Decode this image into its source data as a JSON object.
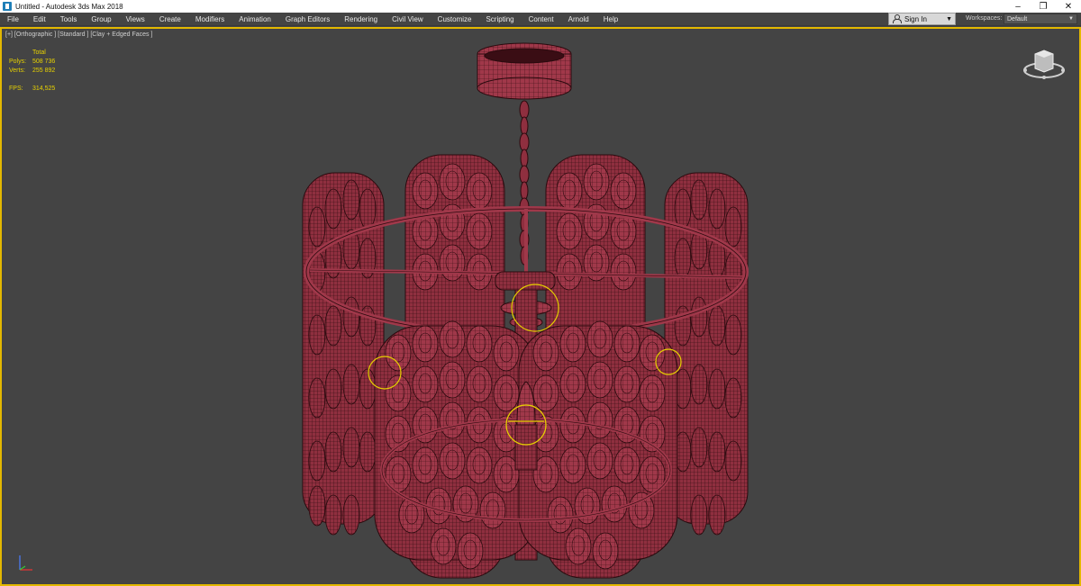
{
  "window": {
    "title": "Untitled - Autodesk 3ds Max 2018",
    "controls": {
      "minimize": "–",
      "restore": "❐",
      "close": "✕"
    }
  },
  "menu": [
    "File",
    "Edit",
    "Tools",
    "Group",
    "Views",
    "Create",
    "Modifiers",
    "Animation",
    "Graph Editors",
    "Rendering",
    "Civil View",
    "Customize",
    "Scripting",
    "Content",
    "Arnold",
    "Help"
  ],
  "account": {
    "sign_in_label": "Sign In",
    "caret": "▼"
  },
  "workspaces": {
    "label": "Workspaces:",
    "value": "Default",
    "caret": "▼"
  },
  "viewport": {
    "label": "[+] [Orthographic ] [Standard ] [Clay + Edged Faces ]",
    "stats": {
      "header": "Total",
      "polys_label": "Polys:",
      "polys_value": "508 736",
      "verts_label": "Verts:",
      "verts_value": "255 892",
      "fps_label": "FPS:",
      "fps_value": "314,525"
    },
    "object_color": "#a0384a",
    "wire_color": "#2a0a0e",
    "selection_color": "#e6d000"
  }
}
